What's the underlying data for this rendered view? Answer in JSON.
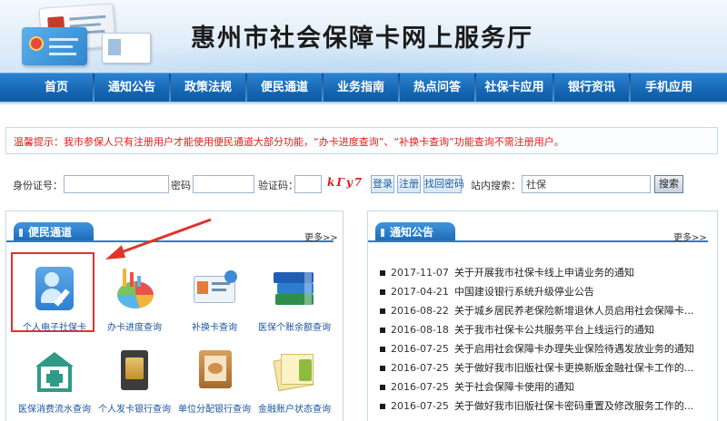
{
  "header": {
    "title": "惠州市社会保障卡网上服务厅",
    "logo_icon": "social-security-cards-icon"
  },
  "nav": {
    "items": [
      {
        "label": "首页"
      },
      {
        "label": "通知公告"
      },
      {
        "label": "政策法规"
      },
      {
        "label": "便民通道"
      },
      {
        "label": "业务指南"
      },
      {
        "label": "热点问答"
      },
      {
        "label": "社保卡应用"
      },
      {
        "label": "银行资讯"
      },
      {
        "label": "手机应用"
      }
    ]
  },
  "notice": {
    "text": "温馨提示：我市参保人只有注册用户才能使用便民通道大部分功能，“办卡进度查询”、“补换卡查询”功能查询不需注册用户。"
  },
  "login": {
    "id_label": "身份证号：",
    "password_label": "密码：",
    "captcha_label": "验证码：",
    "captcha_text": "kΓy7",
    "login_button": "登录",
    "register_button": "注册",
    "forgot_button": "找回密码",
    "search_label": "站内搜索：",
    "search_value": "社保",
    "search_button": "搜索"
  },
  "left_panel": {
    "title": "便民通道",
    "more": "更多>>",
    "services": [
      {
        "label": "个人电子社保卡",
        "icon": "person-pen-icon"
      },
      {
        "label": "办卡进度查询",
        "icon": "pie-chart-icon"
      },
      {
        "label": "补换卡查询",
        "icon": "id-card-icon"
      },
      {
        "label": "医保个账余额查询",
        "icon": "books-icon"
      },
      {
        "label": "医保消费流水查询",
        "icon": "medical-house-icon"
      },
      {
        "label": "个人发卡银行查询",
        "icon": "sim-card-icon"
      },
      {
        "label": "单位分配银行查询",
        "icon": "photo-frame-icon"
      },
      {
        "label": "金融账户状态查询",
        "icon": "folder-icon"
      }
    ]
  },
  "right_panel": {
    "title": "通知公告",
    "more": "更多>>",
    "items": [
      {
        "date": "2017-11-07",
        "title": "关于开展我市社保卡线上申请业务的通知"
      },
      {
        "date": "2017-04-21",
        "title": "中国建设银行系统升级停业公告"
      },
      {
        "date": "2016-08-22",
        "title": "关于城乡居民养老保险新增退休人员启用社会保障卡..."
      },
      {
        "date": "2016-08-18",
        "title": "关于我市社保卡公共服务平台上线运行的通知"
      },
      {
        "date": "2016-07-25",
        "title": "关于启用社会保障卡办理失业保险待遇发放业务的通知"
      },
      {
        "date": "2016-07-25",
        "title": "关于做好我市旧版社保卡更换新版金融社保卡工作的..."
      },
      {
        "date": "2016-07-25",
        "title": "关于社会保障卡使用的通知"
      },
      {
        "date": "2016-07-25",
        "title": "关于做好我市旧版社保卡密码重置及修改服务工作的..."
      }
    ]
  },
  "colors": {
    "nav_blue": "#1667b4",
    "notice_red": "#e0201a",
    "highlight_red": "#e0332b",
    "link_blue": "#1c55a0"
  }
}
